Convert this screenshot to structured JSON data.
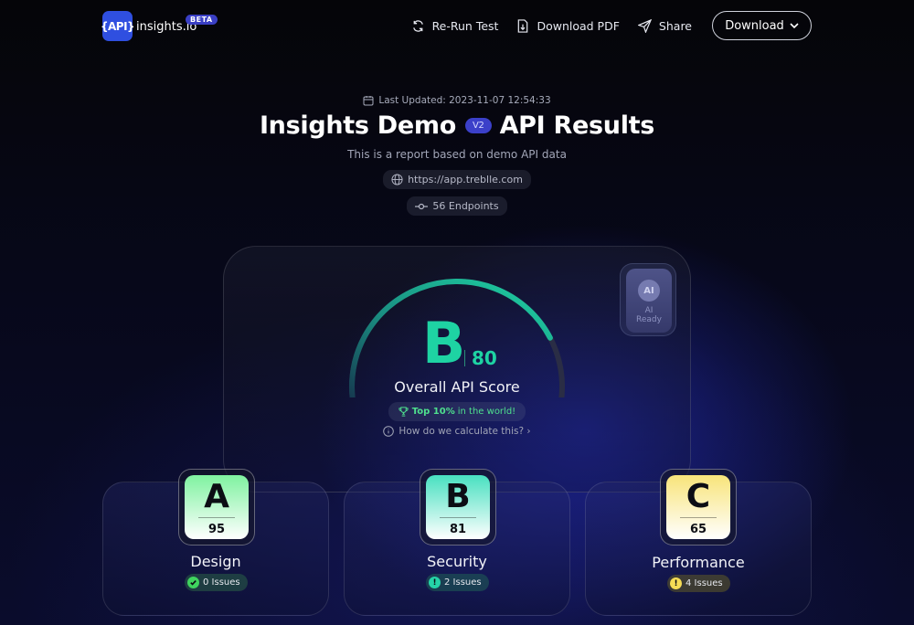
{
  "header": {
    "logo_text": "{API}",
    "app_name": "insights.io",
    "beta_label": "BETA",
    "nav": {
      "rerun_label": "Re-Run Test",
      "pdf_label": "Download PDF",
      "share_label": "Share",
      "download_label": "Download"
    }
  },
  "hero": {
    "last_updated": "Last Updated: 2023-11-07 12:54:33",
    "title_left": "Insights Demo",
    "version": "V2",
    "title_right": "API Results",
    "subtitle": "This is a report based on demo API data",
    "url": "https://app.treblle.com",
    "endpoints": "56 Endpoints"
  },
  "score": {
    "grade": "B",
    "value": "80",
    "label": "Overall API Score",
    "gauge_fraction": 0.8,
    "top_bold": "Top 10%",
    "top_rest": "in the world!",
    "how_link": "How do we calculate this? ›",
    "accent": "#1ed3a3"
  },
  "ai_badge": {
    "icon_label": "AI",
    "line1": "AI",
    "line2": "Ready"
  },
  "categories": [
    {
      "grade": "A",
      "score": "95",
      "name": "Design",
      "issues": "0 Issues",
      "status": "ok",
      "color": "#7ff2a0"
    },
    {
      "grade": "B",
      "score": "81",
      "name": "Security",
      "issues": "2 Issues",
      "status": "warn",
      "color": "#48e0c0"
    },
    {
      "grade": "C",
      "score": "65",
      "name": "Performance",
      "issues": "4 Issues",
      "status": "warn",
      "color": "#f8e47a"
    }
  ]
}
